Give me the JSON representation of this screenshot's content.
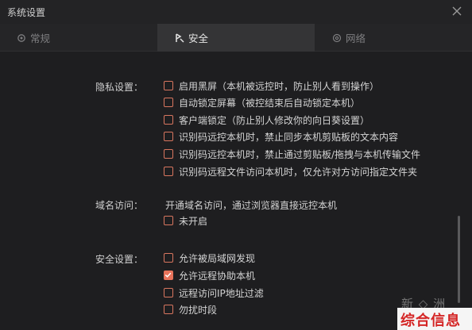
{
  "window": {
    "title": "系统设置"
  },
  "tabs": [
    {
      "label": "常规",
      "icon": "gear-icon",
      "active": false
    },
    {
      "label": "安全",
      "icon": "shield-icon",
      "active": true
    },
    {
      "label": "网络",
      "icon": "network-icon",
      "active": false
    }
  ],
  "privacy": {
    "label": "隐私设置：",
    "options": [
      {
        "label": "启用黑屏（本机被远控时，防止别人看到操作）",
        "checked": false
      },
      {
        "label": "自动锁定屏幕（被控结束后自动锁定本机）",
        "checked": false
      },
      {
        "label": "客户端锁定（防止别人修改你的向日葵设置）",
        "checked": false
      },
      {
        "label": "识别码远控本机时，禁止同步本机剪贴板的文本内容",
        "checked": false
      },
      {
        "label": "识别码远控本机时，禁止通过剪贴板/拖拽与本机传输文件",
        "checked": false
      },
      {
        "label": "识别码远程文件访问本机时，仅允许对方访问指定文件夹",
        "checked": false
      }
    ]
  },
  "domain": {
    "label": "域名访问：",
    "description": "开通域名访问，通过浏览器直接远控本机",
    "options": [
      {
        "label": "未开启",
        "checked": false
      }
    ]
  },
  "security": {
    "label": "安全设置：",
    "options": [
      {
        "label": "允许被局域网发现",
        "checked": false
      },
      {
        "label": "允许远程协助本机",
        "checked": true
      },
      {
        "label": "远程访问IP地址过滤",
        "checked": false
      },
      {
        "label": "勿扰时段",
        "checked": false
      }
    ]
  },
  "watermark": {
    "text": "新 ◇ 洲"
  },
  "badge": {
    "text": "综合信息"
  },
  "colors": {
    "accent": "#e8735b",
    "background": "#1e1e20",
    "active_tab": "#343436"
  }
}
